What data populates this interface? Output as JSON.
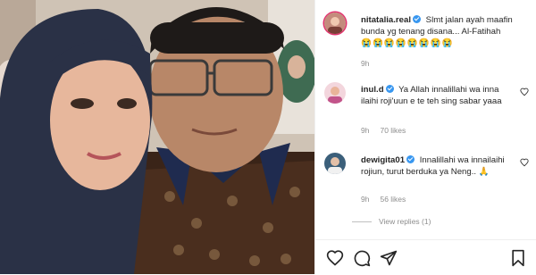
{
  "post": {
    "username": "nitatalia.real",
    "caption": "Slmt jalan ayah maafin bunda yg tenang disana... Al-Fatihah",
    "emojis": "😭😭😭😭😭😭😭😭",
    "time": "9h"
  },
  "comments": [
    {
      "username": "inul.d",
      "text": "Ya Allah innalillahi wa inna ilaihi roji'uun e te teh sing sabar yaaa",
      "time": "9h",
      "likes": "70 likes"
    },
    {
      "username": "dewigita01",
      "text": "Innalillahi wa innailaihi rojiun, turut berduka ya Neng..",
      "emoji": "🙏",
      "time": "9h",
      "likes": "56 likes"
    }
  ],
  "view_replies": "View replies (1)",
  "icons": {
    "verified": "verified-badge-icon",
    "like": "heart-icon",
    "comment": "comment-icon",
    "share": "share-icon",
    "save": "bookmark-icon"
  },
  "colors": {
    "verified": "#3897f0",
    "text": "#262626",
    "muted": "#8e8e8e",
    "border": "#efefef"
  }
}
